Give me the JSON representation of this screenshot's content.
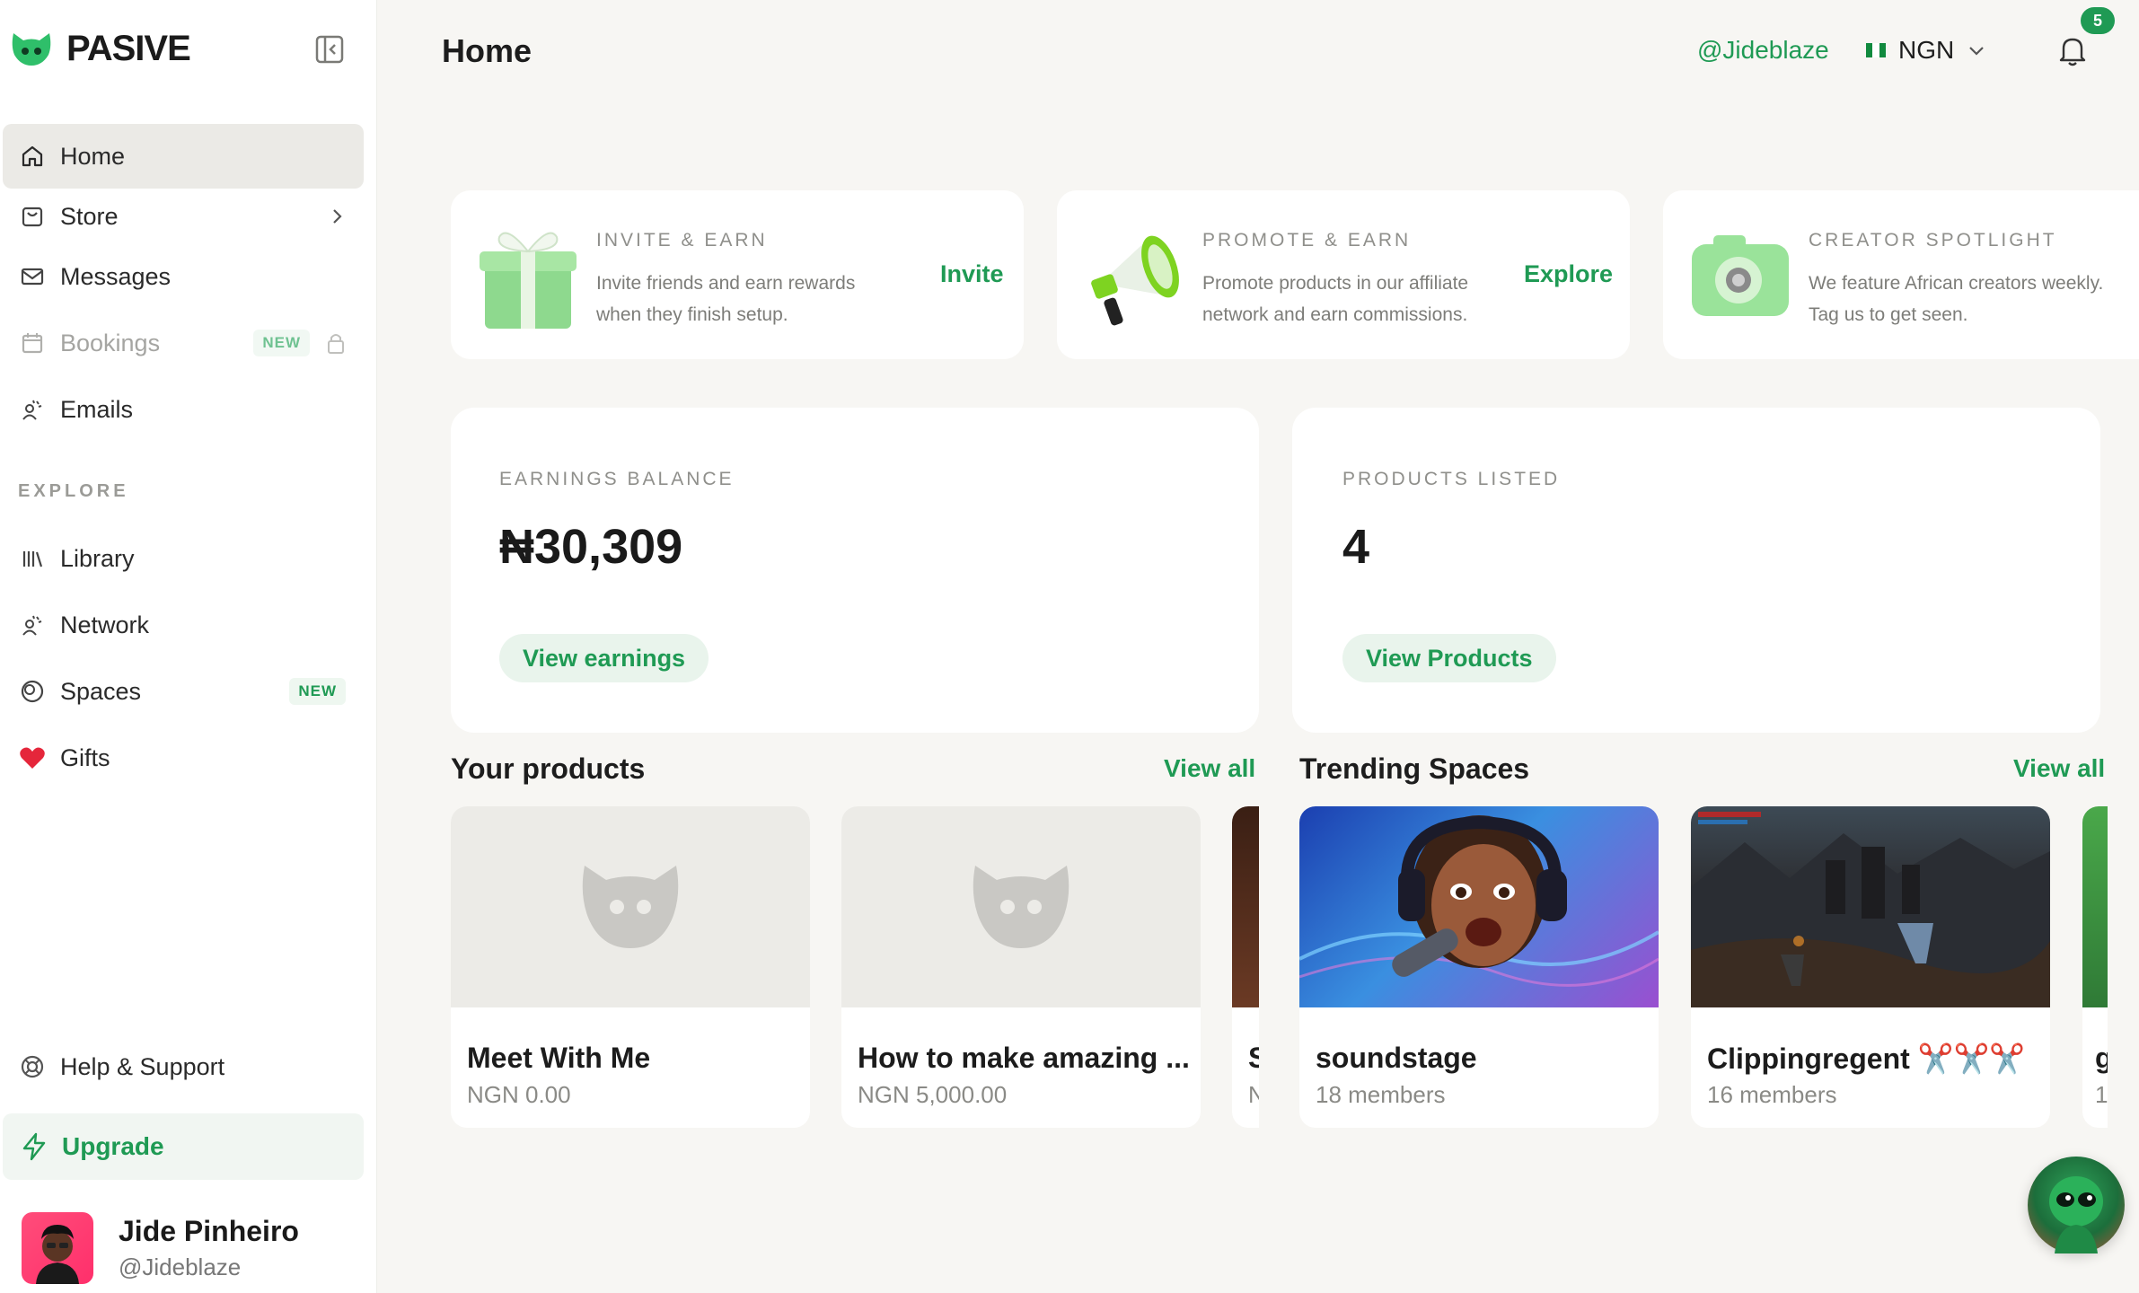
{
  "brand": {
    "name": "PASIVE",
    "accent": "#1f9a54"
  },
  "sidebar": {
    "items": [
      {
        "label": "Home",
        "icon": "home-icon",
        "active": true
      },
      {
        "label": "Store",
        "icon": "store-icon"
      },
      {
        "label": "Messages",
        "icon": "mail-icon"
      },
      {
        "label": "Bookings",
        "icon": "calendar-icon",
        "badge": "NEW",
        "locked": true
      },
      {
        "label": "Emails",
        "icon": "emails-icon"
      }
    ],
    "explore_label": "EXPLORE",
    "explore_items": [
      {
        "label": "Library",
        "icon": "library-icon"
      },
      {
        "label": "Network",
        "icon": "network-icon"
      },
      {
        "label": "Spaces",
        "icon": "spaces-icon",
        "badge": "NEW"
      },
      {
        "label": "Gifts",
        "icon": "heart-icon"
      }
    ],
    "help_label": "Help & Support",
    "upgrade_label": "Upgrade",
    "user": {
      "name": "Jide Pinheiro",
      "handle": "@Jideblaze"
    }
  },
  "header": {
    "title": "Home",
    "handle": "@Jideblaze",
    "currency": "NGN",
    "notification_count": "5"
  },
  "promos": [
    {
      "kicker": "INVITE & EARN",
      "desc": "Invite friends and earn rewards when they finish setup.",
      "cta": "Invite"
    },
    {
      "kicker": "PROMOTE & EARN",
      "desc": "Promote products in our affiliate network and earn commissions.",
      "cta": "Explore"
    },
    {
      "kicker": "CREATOR SPOTLIGHT",
      "desc": "We feature African creators weekly. Tag us to get seen."
    }
  ],
  "stats": {
    "earnings": {
      "label": "EARNINGS BALANCE",
      "value": "₦30,309",
      "button": "View earnings"
    },
    "products": {
      "label": "PRODUCTS LISTED",
      "value": "4",
      "button": "View Products"
    }
  },
  "your_products": {
    "title": "Your products",
    "view_all": "View all",
    "items": [
      {
        "name": "Meet With Me",
        "price": "NGN 0.00"
      },
      {
        "name": "How to make amazing ...",
        "price": "NGN 5,000.00"
      }
    ],
    "peek": {
      "name": "S",
      "price": "N"
    }
  },
  "trending_spaces": {
    "title": "Trending Spaces",
    "view_all": "View all",
    "items": [
      {
        "name": "soundstage",
        "members": "18 members"
      },
      {
        "name": "Clippingregent ✂️✂️✂️",
        "members": "16 members"
      }
    ],
    "peek": {
      "name": "g",
      "members": "1"
    }
  }
}
